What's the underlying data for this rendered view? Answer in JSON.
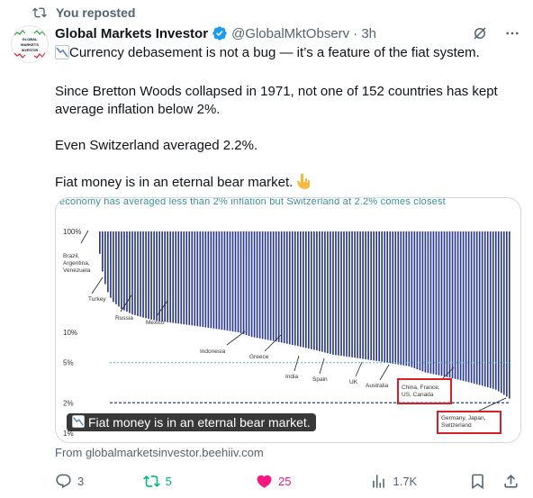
{
  "repost": {
    "label": "You reposted"
  },
  "author": {
    "avatar_text": [
      "GLOBAL",
      "MARKETS",
      "INVESTOR"
    ],
    "name": "Global Markets Investor",
    "handle": "@GlobalMktObserv",
    "time": "· 3h"
  },
  "tweet": {
    "line1": "Currency debasement is not a bug — it’s a feature of the fiat system.",
    "line2": "Since Bretton Woods collapsed in 1971, not one of 152 countries has kept average inflation below 2%.",
    "line3": "Even Switzerland averaged 2.2%.",
    "line4": "Fiat money is in an eternal bear market."
  },
  "media": {
    "caption": "economy has averaged less than 2% inflation but Switzerland at 2.2% comes closest",
    "badge": "Fiat money is in an eternal bear market.",
    "y_ticks": [
      "100%",
      "10%",
      "5%",
      "2%",
      "1%"
    ],
    "annotations": {
      "brazil": [
        "Brazil,",
        "Argentina,",
        "Venezuela"
      ],
      "turkey": "Turkey",
      "russia": "Russia",
      "mexico": "Mexico",
      "indonesia": "Indonesia",
      "greece": "Greece",
      "india": "India",
      "spain": "Spain",
      "uk": "UK",
      "australia": "Australia",
      "china": [
        "China, France,",
        "US, Canada"
      ],
      "germany": [
        "Germany, Japan,",
        "Switzerland"
      ]
    }
  },
  "chart_data": {
    "type": "bar",
    "title": "",
    "ylabel": "",
    "yscale": "log",
    "ylim": [
      1,
      100
    ],
    "y_ticks": [
      "100%",
      "10%",
      "5%",
      "2%",
      "1%"
    ],
    "reference_lines": [
      5,
      2
    ],
    "note": "152 countries sorted by average inflation since 1971, descending",
    "values": [
      100,
      60,
      40,
      30,
      25,
      22,
      20,
      19,
      18,
      17,
      16.5,
      16,
      15.5,
      15,
      14.8,
      14.5,
      14.3,
      14,
      13.8,
      13.6,
      13.4,
      13.2,
      13,
      12.9,
      12.8,
      12.7,
      12.6,
      12.5,
      12.4,
      12.3,
      12.2,
      12.1,
      12,
      11.9,
      11.8,
      11.7,
      11.6,
      11.5,
      11.4,
      11.3,
      11.2,
      11.1,
      11,
      10.9,
      10.8,
      10.7,
      10.6,
      10.5,
      10.4,
      10.3,
      10.2,
      10.1,
      10,
      9.8,
      9.6,
      9.4,
      9.2,
      9,
      8.9,
      8.8,
      8.7,
      8.6,
      8.5,
      8.4,
      8.3,
      8.2,
      8.1,
      8,
      7.9,
      7.8,
      7.7,
      7.6,
      7.5,
      7.4,
      7.3,
      7.2,
      7.1,
      7,
      6.9,
      6.8,
      6.7,
      6.6,
      6.5,
      6.4,
      6.3,
      6.2,
      6.1,
      6,
      5.95,
      5.9,
      5.85,
      5.8,
      5.75,
      5.7,
      5.65,
      5.6,
      5.55,
      5.5,
      5.45,
      5.4,
      5.35,
      5.3,
      5.25,
      5.2,
      5.15,
      5.1,
      5.05,
      5,
      4.95,
      4.9,
      4.85,
      4.8,
      4.75,
      4.7,
      4.65,
      4.6,
      4.5,
      4.4,
      4.3,
      4.2,
      4.1,
      4,
      3.95,
      3.9,
      3.85,
      3.8,
      3.75,
      3.7,
      3.65,
      3.6,
      3.55,
      3.5,
      3.45,
      3.4,
      3.35,
      3.3,
      3.25,
      3.2,
      3.15,
      3.1,
      3.05,
      3,
      2.95,
      2.9,
      2.85,
      2.8,
      2.75,
      2.7,
      2.6,
      2.5,
      2.4,
      2.3,
      2.2
    ],
    "bar_color": "#2b3a8a"
  },
  "source": "From globalmarketsinvestor.beehiiv.com",
  "actions": {
    "replies": "3",
    "reposts": "5",
    "likes": "25",
    "views": "1.7K"
  },
  "colors": {
    "accent": "#1d9bf0",
    "repost_green": "#00ba7c",
    "like_pink": "#f91880",
    "annotation_red": "#d62027"
  }
}
